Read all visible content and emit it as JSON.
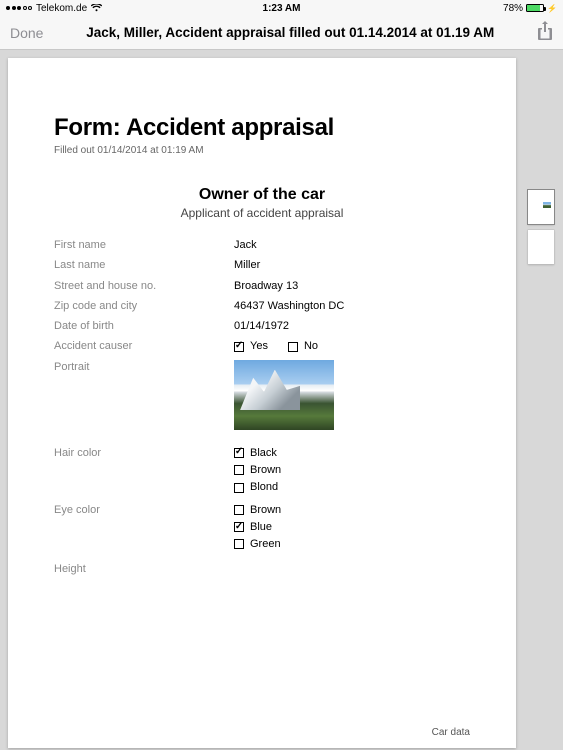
{
  "status": {
    "carrier": "Telekom.de",
    "time": "1:23 AM",
    "battery_pct": "78%"
  },
  "nav": {
    "done": "Done",
    "title": "Jack, Miller, Accident appraisal filled out 01.14.2014 at 01.19 AM"
  },
  "form": {
    "title": "Form: Accident appraisal",
    "filled_out": "Filled out 01/14/2014 at 01:19 AM",
    "section_title": "Owner of the car",
    "section_sub": "Applicant of accident appraisal",
    "labels": {
      "first_name": "First name",
      "last_name": "Last name",
      "street": "Street and house no.",
      "zip_city": "Zip code and city",
      "dob": "Date of birth",
      "accident_causer": "Accident causer",
      "portrait": "Portrait",
      "hair_color": "Hair color",
      "eye_color": "Eye color",
      "height": "Height"
    },
    "values": {
      "first_name": "Jack",
      "last_name": "Miller",
      "street": "Broadway 13",
      "zip_city": "46437 Washington DC",
      "dob": "01/14/1972"
    },
    "accident_causer_opts": {
      "yes": "Yes",
      "no": "No"
    },
    "hair_opts": {
      "black": "Black",
      "brown": "Brown",
      "blond": "Blond"
    },
    "eye_opts": {
      "brown": "Brown",
      "blue": "Blue",
      "green": "Green"
    },
    "footer": "Car data"
  }
}
